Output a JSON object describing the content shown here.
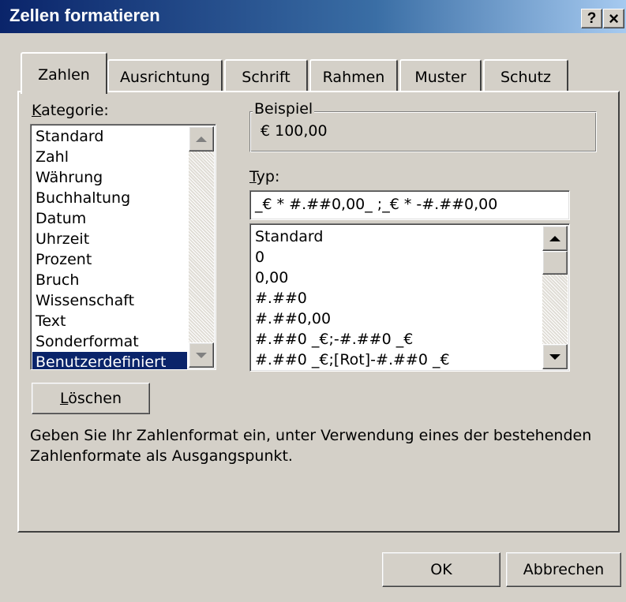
{
  "window": {
    "title": "Zellen formatieren",
    "help_button": "?",
    "close_button": "×"
  },
  "tabs": [
    "Zahlen",
    "Ausrichtung",
    "Schrift",
    "Rahmen",
    "Muster",
    "Schutz"
  ],
  "active_tab": "Zahlen",
  "kategorie": {
    "label_prefix": "K",
    "label_rest": "ategorie:",
    "items": [
      "Standard",
      "Zahl",
      "Währung",
      "Buchhaltung",
      "Datum",
      "Uhrzeit",
      "Prozent",
      "Bruch",
      "Wissenschaft",
      "Text",
      "Sonderformat",
      "Benutzerdefiniert"
    ],
    "selected": "Benutzerdefiniert"
  },
  "beispiel": {
    "label": "Beispiel",
    "value": "€ 100,00"
  },
  "typ": {
    "label_prefix": "T",
    "label_rest": "yp:",
    "value": "_€ * #.##0,00_ ;_€ * -#.##0,00",
    "items": [
      "Standard",
      "0",
      "0,00",
      "#.##0",
      "#.##0,00",
      "#.##0 _€;-#.##0 _€",
      "#.##0 _€;[Rot]-#.##0 _€"
    ]
  },
  "delete_button": {
    "prefix": "L",
    "rest": "öschen"
  },
  "description": {
    "line1": "Geben Sie Ihr Zahlenformat ein, unter Verwendung eines der bestehenden",
    "line2": "Zahlenformate als Ausgangspunkt."
  },
  "footer": {
    "ok": "OK",
    "cancel": "Abbrechen"
  }
}
